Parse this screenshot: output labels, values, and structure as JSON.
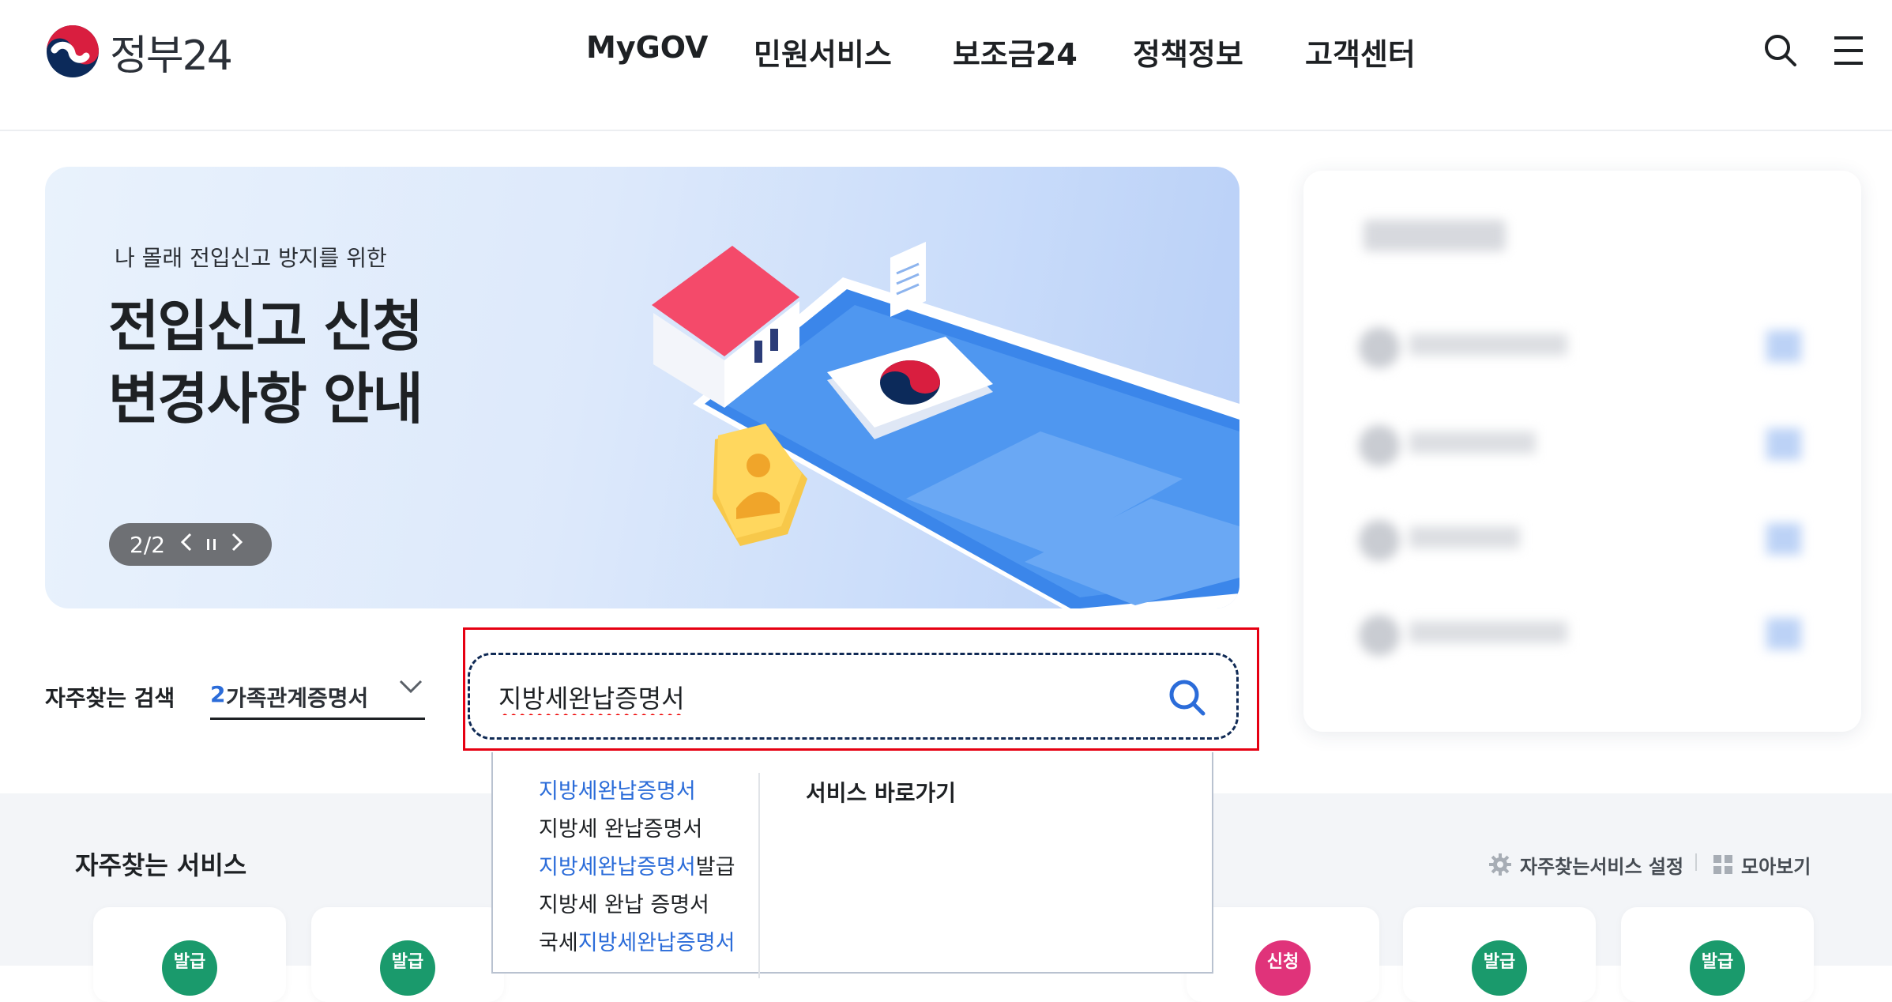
{
  "header": {
    "logo_text": "정부24",
    "nav": [
      "MyGOV",
      "민원서비스",
      "보조금24",
      "정책정보",
      "고객센터"
    ],
    "icons": [
      "search-icon",
      "menu-icon"
    ]
  },
  "banner": {
    "subtitle": "나 몰래 전입신고 방지를 위한",
    "title_line1": "전입신고 신청",
    "title_line2": "변경사항 안내",
    "pager": "2/2"
  },
  "search": {
    "frequent_label": "자주찾는 검색",
    "frequent_rank": "2",
    "frequent_value": "가족관계증명서",
    "query": "지방세완납증명서",
    "highlight_color": "#e60012"
  },
  "autocomplete": {
    "suggestions": [
      {
        "pre": "",
        "match": "지방세완납증명서",
        "post": ""
      },
      {
        "pre": "지방세 완납증명서",
        "match": "",
        "post": ""
      },
      {
        "pre": "",
        "match": "지방세완납증명서",
        "post": "발급"
      },
      {
        "pre": "지방세 완납 증명서",
        "match": "",
        "post": ""
      },
      {
        "pre": "국세",
        "match": "지방세완납증명서",
        "post": ""
      }
    ],
    "shortcut_heading": "서비스 바로가기"
  },
  "services": {
    "title": "자주찾는 서비스",
    "settings_label": "자주찾는서비스 설정",
    "view_all_label": "모아보기",
    "badges": [
      {
        "label": "발급",
        "color": "#1a9a6c"
      },
      {
        "label": "발급",
        "color": "#1a9a6c"
      },
      {
        "label": "신청",
        "color": "#e0337a"
      },
      {
        "label": "발급",
        "color": "#1a9a6c"
      },
      {
        "label": "발급",
        "color": "#1a9a6c"
      }
    ]
  }
}
